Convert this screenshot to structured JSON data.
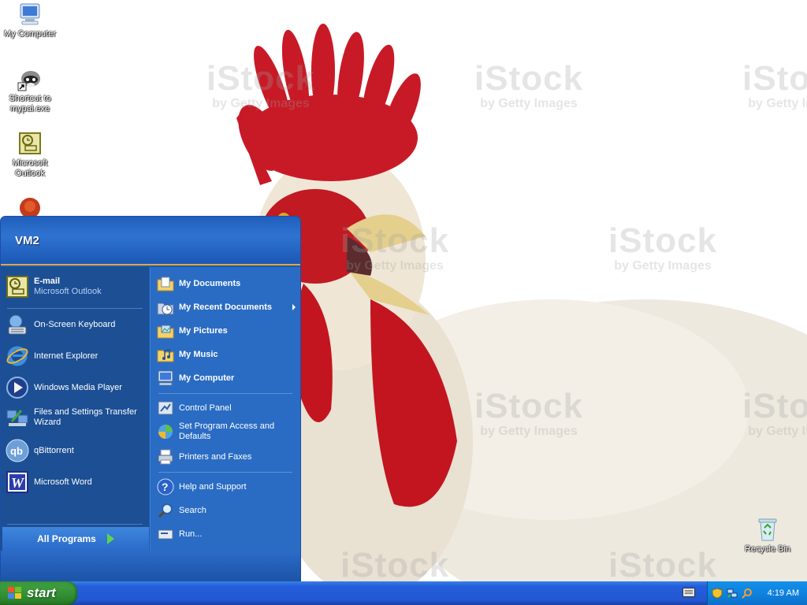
{
  "desktop": {
    "icons": [
      {
        "label": "My Computer"
      },
      {
        "label": "Shortcut to mypal.exe"
      },
      {
        "label": "Microsoft Outlook"
      },
      {
        "label": "Recycle Bin"
      }
    ],
    "watermark": {
      "brand": "iStock",
      "sub": "by Getty Images"
    }
  },
  "start_menu": {
    "user": "VM2",
    "pinned": [
      {
        "label": "E-mail",
        "sub": "Microsoft Outlook"
      }
    ],
    "recent": [
      {
        "label": "On-Screen Keyboard"
      },
      {
        "label": "Internet Explorer"
      },
      {
        "label": "Windows Media Player"
      },
      {
        "label": "Files and Settings Transfer Wizard"
      },
      {
        "label": "qBittorrent"
      },
      {
        "label": "Microsoft Word"
      }
    ],
    "all_programs": "All Programs",
    "right_places": [
      {
        "label": "My Documents"
      },
      {
        "label": "My Recent Documents"
      },
      {
        "label": "My Pictures"
      },
      {
        "label": "My Music"
      },
      {
        "label": "My Computer"
      }
    ],
    "right_settings": [
      {
        "label": "Control Panel"
      },
      {
        "label": "Set Program Access and Defaults"
      },
      {
        "label": "Printers and Faxes"
      }
    ],
    "right_help": [
      {
        "label": "Help and Support"
      },
      {
        "label": "Search"
      },
      {
        "label": "Run..."
      }
    ]
  },
  "taskbar": {
    "start_label": "start",
    "clock": "4:19 AM"
  },
  "colors": {
    "taskbar_blue": "#245edb",
    "start_green": "#3b9a3b",
    "tray_blue": "#0f83e0",
    "menu_header_blue": "#2f73d0",
    "menu_left": "#1c4f94",
    "menu_right": "#2a6cc4",
    "accent_orange": "#e2a642"
  }
}
